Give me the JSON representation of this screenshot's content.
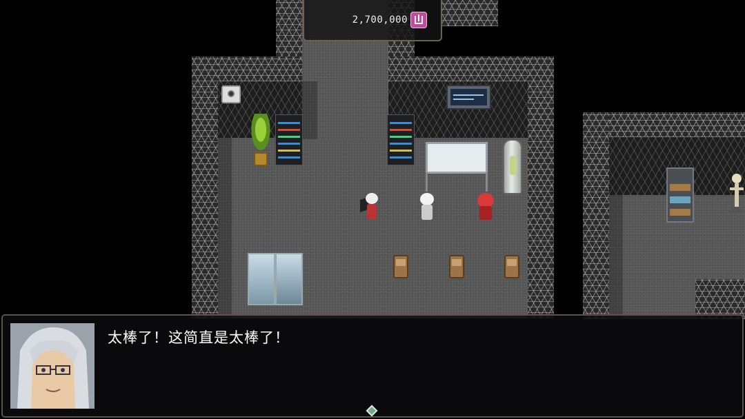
{
  "hud": {
    "gold_amount": "2,700,000",
    "currency_icon": "gold-bag-icon"
  },
  "dialogue": {
    "text": "太棒了！这简直是太棒了！",
    "speaker_portrait": "silver-haired man with glasses"
  },
  "colors": {
    "window_border": "#5d5448",
    "window_bg": "#0c0c0e",
    "currency_icon": "#c04a9b",
    "floor": "#5b5b5b"
  }
}
